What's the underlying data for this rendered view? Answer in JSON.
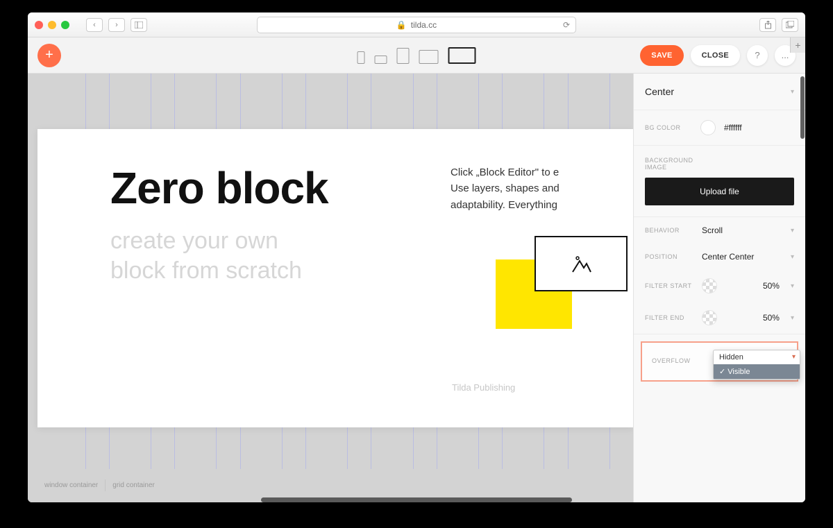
{
  "browser": {
    "url_display": "tilda.cc",
    "lock_icon": "lock"
  },
  "toolbar": {
    "save_label": "SAVE",
    "close_label": "CLOSE",
    "help_icon": "?",
    "more_icon": "..."
  },
  "canvas": {
    "heading": "Zero block",
    "subtitle_line1": "create your own",
    "subtitle_line2": "block from scratch",
    "description_line1": "Click „Block Editor\" to e",
    "description_line2": "Use layers, shapes and",
    "description_line3": "adaptability. Everything",
    "brand": "Tilda Publishing",
    "footer_label_window": "window container",
    "footer_label_grid": "grid container"
  },
  "panel": {
    "align_value": "Center",
    "bg_color_label": "BG COLOR",
    "bg_color_value": "#ffffff",
    "bg_image_label": "BACKGROUND IMAGE",
    "upload_label": "Upload file",
    "behavior_label": "BEHAVIOR",
    "behavior_value": "Scroll",
    "position_label": "POSITION",
    "position_value": "Center Center",
    "filter_start_label": "FILTER START",
    "filter_start_value": "50%",
    "filter_end_label": "FILTER END",
    "filter_end_value": "50%",
    "overflow_label": "OVERFLOW",
    "overflow_options": {
      "hidden": "Hidden",
      "visible": "Visible"
    },
    "overflow_selected": "Visible"
  }
}
